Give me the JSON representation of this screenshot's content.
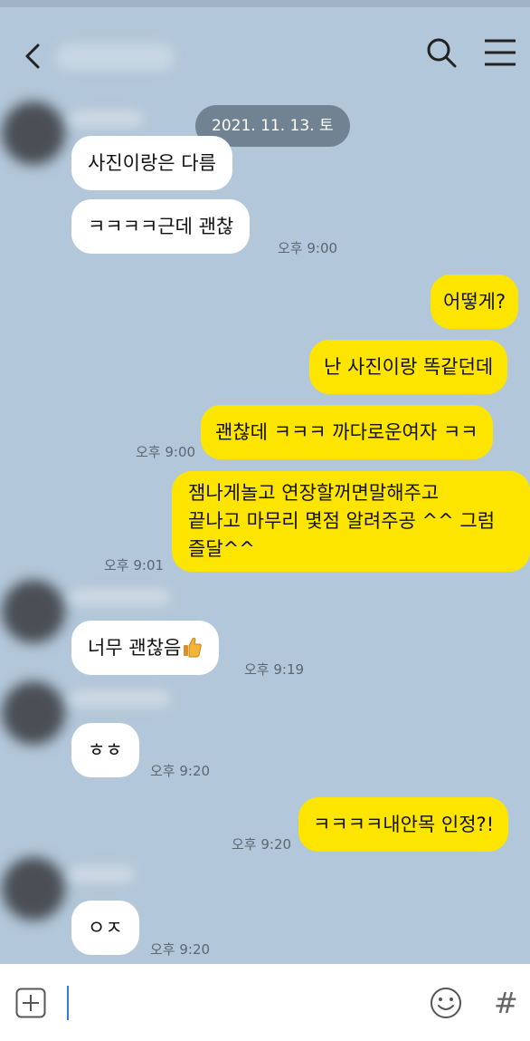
{
  "header": {
    "back_icon": "chevron-left-icon",
    "search_icon": "search-icon",
    "menu_icon": "hamburger-menu-icon"
  },
  "date_divider": "2021. 11. 13. 토",
  "messages": [
    {
      "id": "m1",
      "from": "them",
      "text": "사진이랑은 다름"
    },
    {
      "id": "m2",
      "from": "them",
      "text": "ㅋㅋㅋㅋ근데 괜찮",
      "time": "오후 9:00"
    },
    {
      "id": "m3",
      "from": "me",
      "text": "어떻게?"
    },
    {
      "id": "m4",
      "from": "me",
      "text": "난 사진이랑 똑같던데"
    },
    {
      "id": "m5",
      "from": "me",
      "text": "괜찮데 ㅋㅋㅋ 까다로운여자 ㅋㅋ",
      "time": "오후 9:00"
    },
    {
      "id": "m6",
      "from": "me",
      "lines": [
        "잼나게놀고 연장할꺼면말해주고",
        "끝나고 마무리 몇점 알려주공 ^^ 그럼",
        "즐달^^"
      ],
      "time": "오후 9:01"
    },
    {
      "id": "m7",
      "from": "them",
      "text": "너무 괜찮음",
      "emoji": "thumbs-up-icon",
      "time": "오후 9:19"
    },
    {
      "id": "m8",
      "from": "them",
      "text": "ㅎㅎ",
      "time": "오후 9:20"
    },
    {
      "id": "m9",
      "from": "me",
      "text": "ㅋㅋㅋㅋ내안목 인정?!",
      "time": "오후 9:20"
    },
    {
      "id": "m10",
      "from": "them",
      "text": "ㅇㅈ",
      "time": "오후 9:20"
    }
  ],
  "input": {
    "plus_icon": "plus-square-icon",
    "emoji_icon": "emoji-smile-icon",
    "hash_label": "#"
  },
  "colors": {
    "background": "#b2c7d9",
    "outgoing_bubble": "#fee500",
    "incoming_bubble": "#ffffff"
  }
}
